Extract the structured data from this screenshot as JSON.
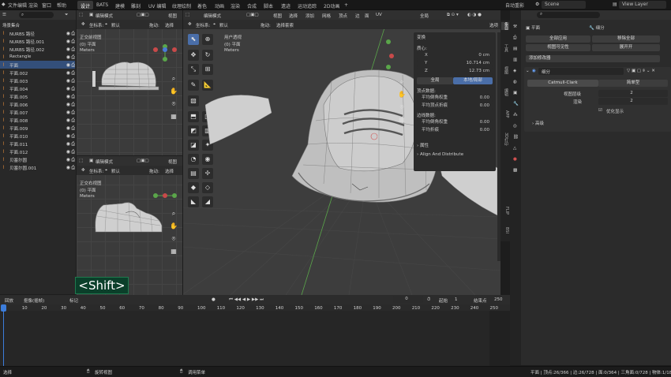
{
  "menu": {
    "items": [
      "文件",
      "编辑",
      "渲染",
      "窗口",
      "帮助"
    ]
  },
  "workspaces": {
    "tabs": [
      "设计",
      "BATS",
      "建模",
      "雕刻",
      "UV 编辑",
      "纹理绘制",
      "着色",
      "动画",
      "渲染",
      "合成",
      "脚本",
      "遗迹",
      "运动追踪",
      "2D动画"
    ],
    "add": "+"
  },
  "topright": {
    "autosave": "自动重影",
    "scene": "Scene",
    "layer": "View Layer"
  },
  "outliner": {
    "title": "场景集合",
    "items": [
      {
        "name": "NURBS 路径"
      },
      {
        "name": "NURBS 路径.001"
      },
      {
        "name": "NURBS 路径.002"
      },
      {
        "name": "Rectangle"
      },
      {
        "name": "平面"
      },
      {
        "name": "平面.002"
      },
      {
        "name": "平面.003"
      },
      {
        "name": "平面.004"
      },
      {
        "name": "平面.005"
      },
      {
        "name": "平面.006"
      },
      {
        "name": "平面.007"
      },
      {
        "name": "平面.008"
      },
      {
        "name": "平面.009"
      },
      {
        "name": "平面.010"
      },
      {
        "name": "平面.011"
      },
      {
        "name": "平面.012"
      },
      {
        "name": "贝塞尔圆"
      },
      {
        "name": "贝塞尔圆.001"
      }
    ]
  },
  "vp_top": {
    "mode": "编辑模式",
    "view": "视图",
    "coord": "坐标系:",
    "coord_val": "默认",
    "drag": "拖动:",
    "drag_val": "选择 ",
    "title": "正交前视图",
    "obj": "(0) 平面",
    "unit": "Meters"
  },
  "vp_bottom": {
    "mode": "编辑模式",
    "view": "视图",
    "coord": "坐标系:",
    "coord_val": "默认",
    "drag": "拖动:",
    "drag_val": "选择",
    "title": "正交右视图",
    "obj": "(0) 平面",
    "unit": "Meters"
  },
  "vp_main": {
    "mode": "编辑模式",
    "menus": [
      "视图",
      "选择",
      "添加",
      "网格",
      "顶点",
      "边",
      "面",
      "UV"
    ],
    "global": "全局",
    "coord": "坐标系:",
    "coord_val": "默认",
    "drag": "拖动:",
    "drag_val": "选择套索",
    "options": "选项",
    "title": "用户透视",
    "obj": "(0) 平面",
    "unit": "Meters"
  },
  "npanel": {
    "transform": "变换",
    "median": "质心:",
    "x_label": "X",
    "x": "0 cm",
    "y_label": "Y",
    "y": "10.714 cm",
    "z_label": "Z",
    "z": "12.73 cm",
    "global_btn": "全局",
    "local_btn": "本地/局部",
    "vertex_data": "顶点数据:",
    "vw_label": "平均倒角权重",
    "vw": "0.00",
    "vc_label": "平均顶点折痕",
    "vc": "0.00",
    "edge_data": "边线数据:",
    "ew_label": "平均倒角权重",
    "ew": "0.00",
    "ec_label": "平均折痕",
    "ec": "0.00",
    "attrs": "属性",
    "align": "Align And Distribute",
    "tabs": [
      "条目",
      "工具",
      "视图",
      "编辑",
      "APP",
      "3D打印",
      "FLIP",
      "BSI"
    ]
  },
  "props": {
    "obj": "平面",
    "mod": "细分",
    "apply_all": "全部应用",
    "delete_all": "移除全部",
    "viewport_vis": "视图可见性",
    "expand": "展开开",
    "add_mod": "添加修改器",
    "mod_name": "细分",
    "catmull": "Catmull-Clark",
    "simple": "简单型",
    "levels_label": "视图层级",
    "levels": "2",
    "render_label": "渲染",
    "render": "2",
    "optimal": "优化显示",
    "advanced": "高级"
  },
  "shift_key": "<Shift>",
  "timeline": {
    "menus": [
      "回放",
      "抠像(插帧)",
      "标记"
    ],
    "frame": "0",
    "start_label": "起始",
    "start": "1",
    "end_label": "结束点",
    "end": "250",
    "ticks": [
      "0",
      "10",
      "20",
      "30",
      "40",
      "50",
      "60",
      "70",
      "80",
      "90",
      "100",
      "110",
      "120",
      "130",
      "140",
      "150",
      "160",
      "170",
      "180",
      "190",
      "200",
      "210",
      "220",
      "230",
      "240",
      "250"
    ]
  },
  "status": {
    "left": "选择",
    "mid": "旋转视图",
    "right_menu": "调用菜单",
    "stats": "平面 | 顶点:26/366 | 边:26/728 | 面:0/364 | 三角面:0/728 | 物体:1/18 | 3.2"
  }
}
